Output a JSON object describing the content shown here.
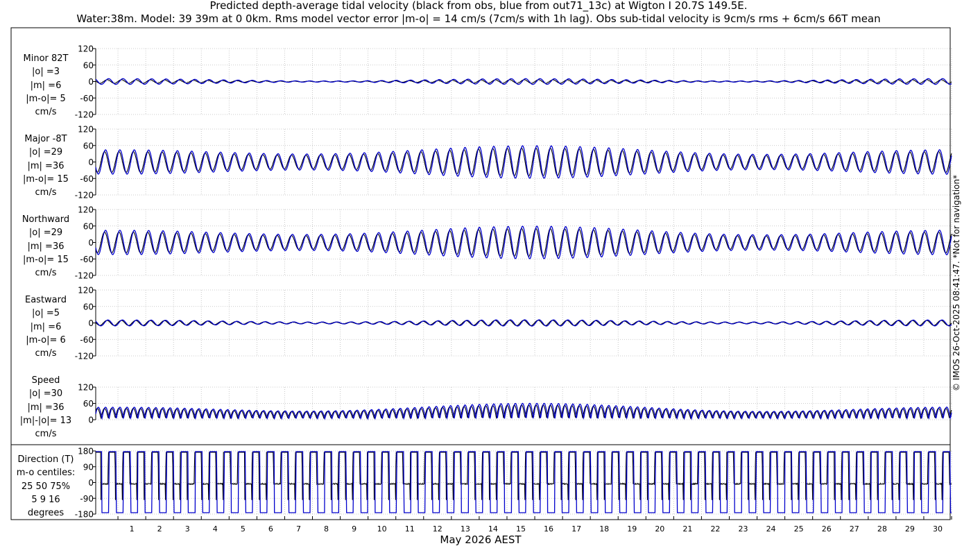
{
  "title_line1": "Predicted depth-average tidal velocity (black from obs, blue from out71_13c) at Wigton I 20.7S 149.5E.",
  "title_line2": "Water:38m. Model: 39 39m at 0 0km. Rms model vector error |m-o| = 14 cm/s (7cm/s with 1h lag). Obs sub-tidal velocity is 9cm/s rms + 6cm/s 66T mean",
  "credit": "© IMOS 26-Oct-2025 08:41:47. *Not for navigation*",
  "chart_data": {
    "type": "line",
    "xlabel": "May 2026 AEST",
    "x_ticks": [
      "1",
      "2",
      "3",
      "4",
      "5",
      "6",
      "7",
      "8",
      "9",
      "10",
      "11",
      "12",
      "13",
      "14",
      "15",
      "16",
      "17",
      "18",
      "19",
      "20",
      "21",
      "22",
      "23",
      "24",
      "25",
      "26",
      "27",
      "28",
      "29",
      "30"
    ],
    "x_range_days": [
      0.2,
      31.0
    ],
    "grid": true,
    "colors": {
      "obs": "#000000",
      "model": "#0000cc"
    },
    "series_legend": [
      "black from obs",
      "blue from out71_13c"
    ],
    "panels": [
      {
        "id": "minor",
        "label_lines": [
          "Minor 82T",
          "|o| =3",
          "|m| =6",
          "|m-o|= 5",
          "cm/s"
        ],
        "yticks": [
          "120",
          "60",
          "0",
          "-60",
          "-120"
        ],
        "ylim": [
          -120,
          120
        ],
        "obs_rms": 3,
        "model_rms": 6
      },
      {
        "id": "major",
        "label_lines": [
          "Major -8T",
          "|o| =29",
          "|m| =36",
          "|m-o|= 15",
          "cm/s"
        ],
        "yticks": [
          "120",
          "60",
          "0",
          "-60",
          "-120"
        ],
        "ylim": [
          -120,
          120
        ],
        "obs_rms": 29,
        "model_rms": 36
      },
      {
        "id": "northward",
        "label_lines": [
          "Northward",
          "|o| =29",
          "|m| =36",
          "|m-o|= 15",
          "cm/s"
        ],
        "yticks": [
          "120",
          "60",
          "0",
          "-60",
          "-120"
        ],
        "ylim": [
          -120,
          120
        ],
        "obs_rms": 29,
        "model_rms": 36
      },
      {
        "id": "eastward",
        "label_lines": [
          "Eastward",
          "|o| =5",
          "|m| =6",
          "|m-o|= 6",
          "cm/s"
        ],
        "yticks": [
          "120",
          "60",
          "0",
          "-60",
          "-120"
        ],
        "ylim": [
          -120,
          120
        ],
        "obs_rms": 5,
        "model_rms": 6
      },
      {
        "id": "speed",
        "label_lines": [
          "Speed",
          "|o| =30",
          "|m| =36",
          "|m|-|o|= 13",
          "cm/s"
        ],
        "yticks": [
          "120",
          "60",
          "0"
        ],
        "ylim": [
          0,
          120
        ],
        "obs_rms": 30,
        "model_rms": 36
      },
      {
        "id": "direction",
        "label_lines": [
          "Direction (T)",
          "m-o centiles:",
          "25  50  75%",
          "5   9  16",
          "degrees"
        ],
        "yticks": [
          "180",
          "90",
          "0",
          "-90",
          "-180"
        ],
        "ylim": [
          -180,
          180
        ],
        "centiles": [
          5,
          9,
          16
        ]
      }
    ]
  }
}
